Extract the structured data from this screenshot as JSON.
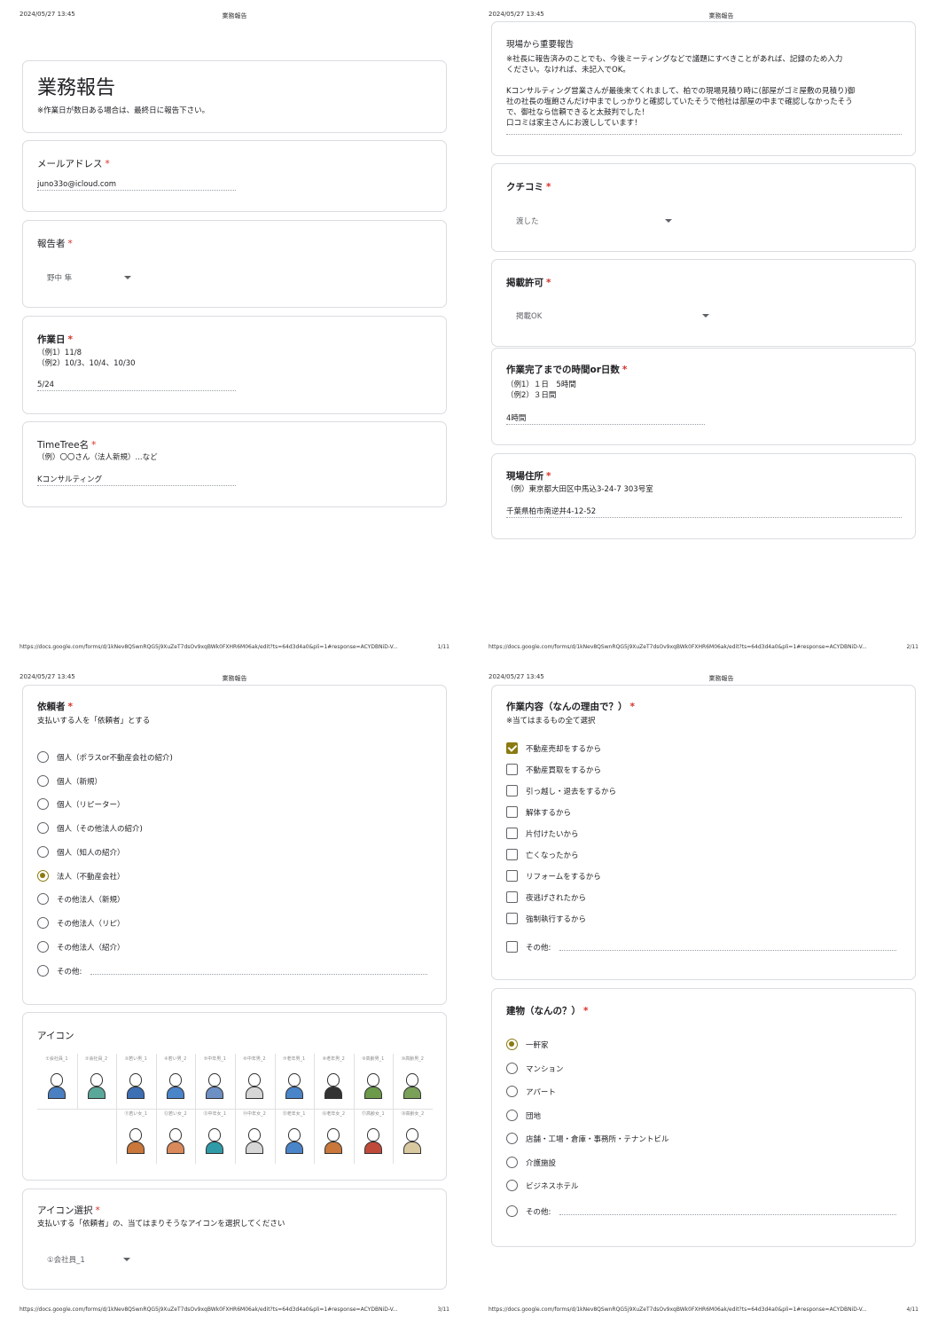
{
  "header": {
    "date": "2024/05/27 13:45",
    "title": "業務報告"
  },
  "footer": {
    "url": "https://docs.google.com/forms/d/1kNev8QSwnRQG5j9XuZeT7dsOv9xqBWk0FXHR6M06ak/edit?ts=64d3d4a0&pli=1#response=ACYDBNiD-V...",
    "pages": [
      "1/11",
      "2/11",
      "3/11",
      "4/11"
    ]
  },
  "form": {
    "title": "業務報告",
    "description": "※作業日が数日ある場合は、最終日に報告下さい。"
  },
  "required_mark": "*",
  "email": {
    "label": "メールアドレス",
    "value": "juno33o@icloud.com"
  },
  "reporter": {
    "label": "報告者",
    "value": "野中 隼"
  },
  "work_date": {
    "label": "作業日",
    "hint1": "（例1）11/8",
    "hint2": "（例2）10/3、10/4、10/30",
    "value": "5/24"
  },
  "timetree": {
    "label": "TimeTree名",
    "hint": "（例）〇〇さん（法人新規）...など",
    "value": "Kコンサルティング"
  },
  "important": {
    "label": "現場から重要報告",
    "hint1": "※社長に報告済みのことでも、今後ミーティングなどで議題にすべきことがあれば、記録のため入力",
    "hint2": "ください。なければ、未記入でOK。",
    "line1": "Kコンサルティング営業さんが最後来てくれまして、柏での現場見積り時に(部屋がゴミ屋敷の見積り)御",
    "line2": "社の社長の塩飽さんだけ中までしっかりと確認していたそうで他社は部屋の中まで確認しなかったそう",
    "line3": "で、御社なら信頼できると太鼓判でした！",
    "line4": "口コミは家主さんにお渡ししています！"
  },
  "kuchikomi": {
    "label": "クチコミ",
    "value": "渡した"
  },
  "permission": {
    "label": "掲載許可",
    "value": "掲載OK"
  },
  "duration": {
    "label": "作業完了までの時間or日数",
    "hint1": "（例1）１日　5時間",
    "hint2": "（例2）３日間",
    "value": "4時間"
  },
  "address": {
    "label": "現場住所",
    "hint": "（例）東京都大田区中馬込3-24-7 303号室",
    "value": "千葉県柏市南逆井4-12-52"
  },
  "client": {
    "label": "依頼者",
    "hint": "支払いする人を「依頼者」とする",
    "options": [
      "個人（ポラスor不動産会社の紹介)",
      "個人（新規）",
      "個人（リピーター）",
      "個人（その他法人の紹介)",
      "個人（知人の紹介）",
      "法人（不動産会社）",
      "その他法人（新規）",
      "その他法人（リピ）",
      "その他法人（紹介）",
      "その他:"
    ],
    "selected_index": 5
  },
  "icons": {
    "label": "アイコン",
    "row1": [
      "①会社員_1",
      "②会社員_2",
      "③若い男_1",
      "④若い男_2",
      "⑤中年男_1",
      "⑥中年男_2",
      "⑦老年男_1",
      "⑧老年男_2",
      "⑨高齢男_1",
      "⑩高齢男_2"
    ],
    "row2": [
      "⑪若い女_1",
      "⑫若い女_2",
      "⑬中年女_1",
      "⑭中年女_2",
      "⑮老年女_1",
      "⑯老年女_2",
      "⑰高齢女_1",
      "⑱高齢女_2"
    ],
    "colors": [
      "#4a7fc1",
      "#5aa89a",
      "#3d6fb5",
      "#4a84c9",
      "#6c8fc4",
      "#d6d6d6",
      "#4a84c9",
      "#333333",
      "#6a9a4a",
      "#7aa05a",
      "#c9773a",
      "#d9895a",
      "#2f9aa8",
      "#d6d6d6",
      "#4a84c9",
      "#c9773a",
      "#c04a3a",
      "#d9c9a0"
    ]
  },
  "icon_select": {
    "label": "アイコン選択",
    "hint": "支払いする「依頼者」の、当てはまりそうなアイコンを選択してください",
    "value": "①会社員_1"
  },
  "reason": {
    "label": "作業内容（なんの理由で？）",
    "hint": "※当てはまるもの全て選択",
    "options": [
      "不動産売却をするから",
      "不動産買取をするから",
      "引っ越し・退去をするから",
      "解体するから",
      "片付けたいから",
      "亡くなったから",
      "リフォームをするから",
      "夜逃げされたから",
      "強制執行するから",
      "その他:"
    ],
    "checked_index": 0
  },
  "building": {
    "label": "建物（なんの？）",
    "options": [
      "一軒家",
      "マンション",
      "アパート",
      "団地",
      "店舗・工場・倉庫・事務所・テナントビル",
      "介護施設",
      "ビジネスホテル",
      "その他:"
    ],
    "selected_index": 0
  }
}
